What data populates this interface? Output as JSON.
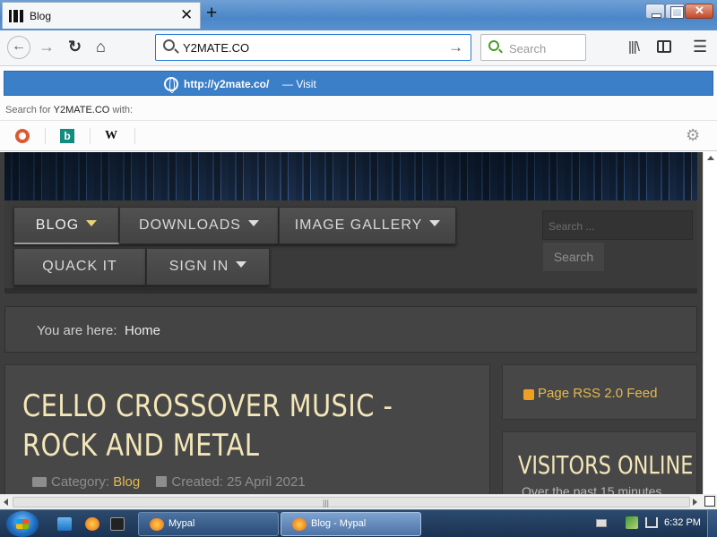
{
  "browser": {
    "tab": {
      "title": "Blog"
    },
    "url_value": "Y2MATE.CO",
    "search_placeholder": "Search"
  },
  "dropdown": {
    "visit_url": "http://y2mate.co/",
    "visit_label": "— Visit",
    "search_for_prefix": "Search for",
    "search_for_term": "Y2MATE.CO",
    "search_for_suffix": "with:",
    "engines": [
      "duckduckgo-icon",
      "bing-icon",
      "wikipedia-icon"
    ],
    "wiki_glyph": "W",
    "bing_glyph": "b"
  },
  "site": {
    "menu": {
      "blog": "BLOG",
      "downloads": "DOWNLOADS",
      "gallery": "IMAGE GALLERY",
      "quack": "QUACK IT",
      "signin": "SIGN IN"
    },
    "search_placeholder": "Search ...",
    "search_button": "Search",
    "breadcrumb": {
      "prefix": "You are here:",
      "home": "Home"
    },
    "article": {
      "title": "CELLO CROSSOVER MUSIC - ROCK AND METAL",
      "category_label": "Category:",
      "category": "Blog",
      "created": "Created: 25 April 2021"
    },
    "rss_label": "Page RSS 2.0 Feed",
    "visitors": {
      "title": "VISITORS ONLINE",
      "subtitle": "Over the past 15 minutes"
    }
  },
  "taskbar": {
    "task1": "Mypal",
    "task2": "Blog - Mypal",
    "clock": "6:32 PM"
  },
  "colors": {
    "accent_blue": "#3a7fc8",
    "site_gold": "#e5b94c",
    "title_cream": "#f3e6b8"
  }
}
